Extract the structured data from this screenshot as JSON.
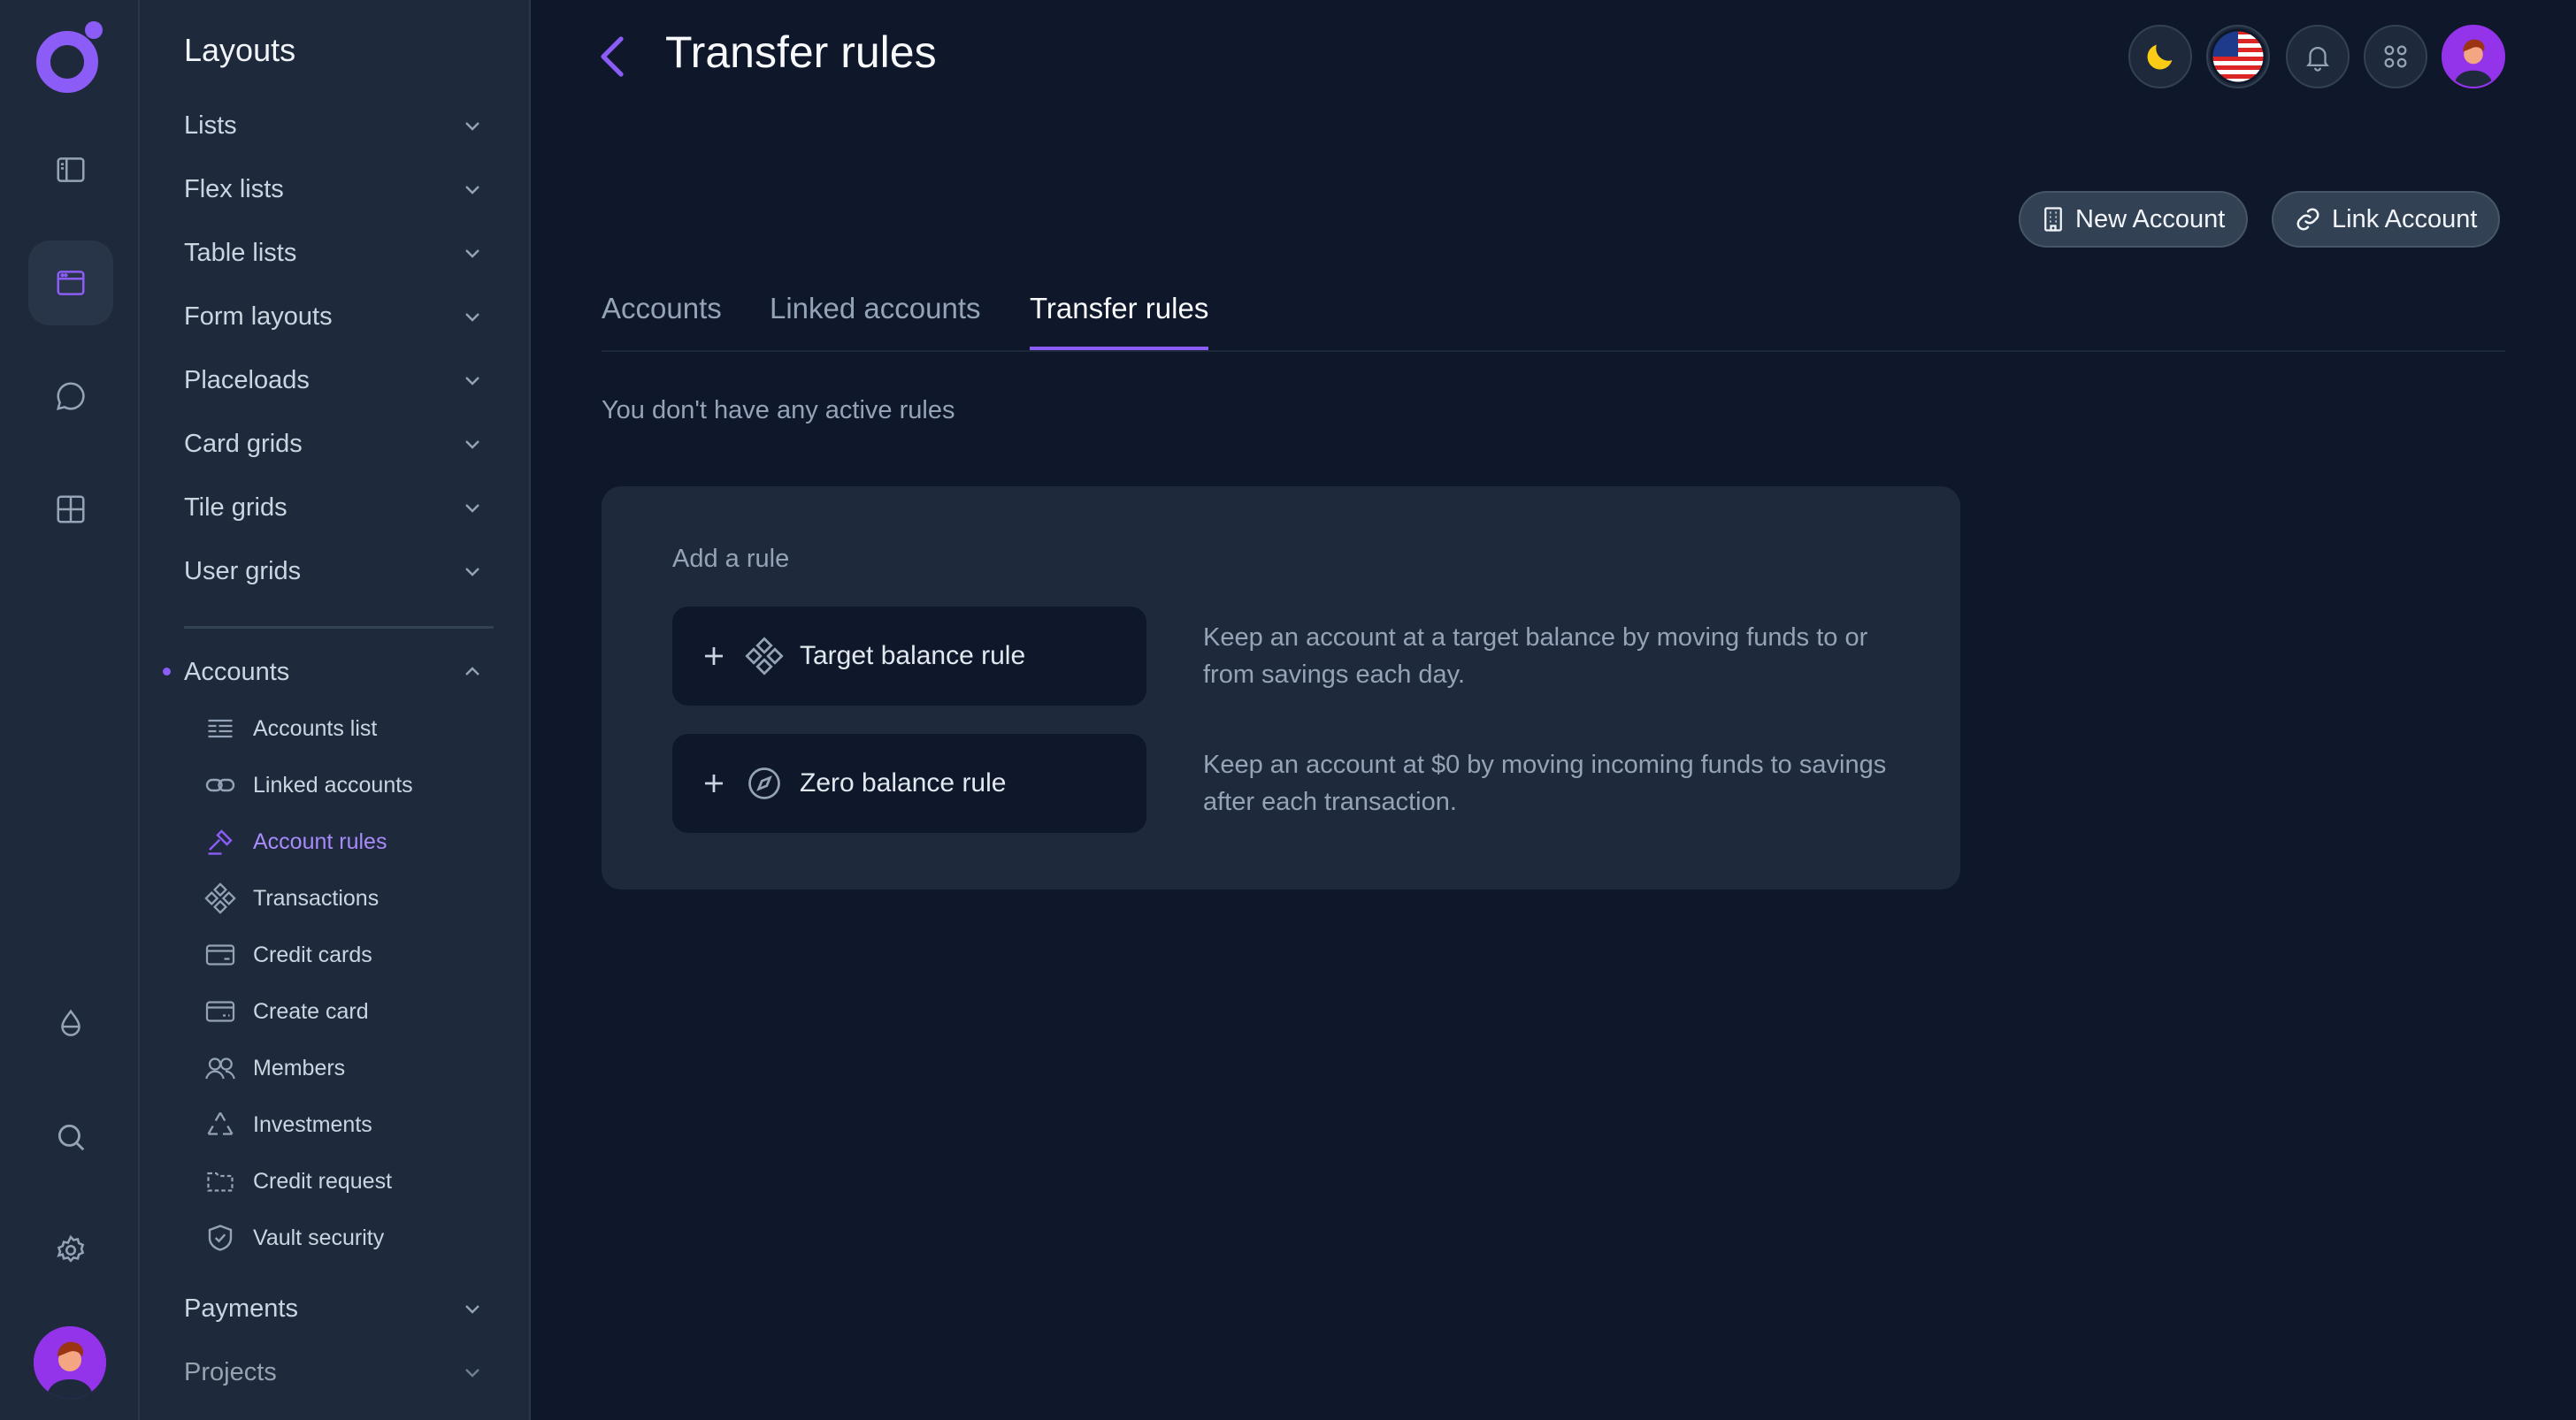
{
  "rail": {
    "icons": [
      "logo",
      "sidebar-icon",
      "window-icon",
      "chat-icon",
      "grid-icon",
      "droplet-icon",
      "search-icon",
      "gear-icon"
    ],
    "accent": "#8b5cf6"
  },
  "subnav": {
    "title": "Layouts",
    "items": [
      {
        "label": "Lists"
      },
      {
        "label": "Flex lists"
      },
      {
        "label": "Table lists"
      },
      {
        "label": "Form layouts"
      },
      {
        "label": "Placeloads"
      },
      {
        "label": "Card grids"
      },
      {
        "label": "Tile grids"
      },
      {
        "label": "User grids"
      }
    ],
    "group": {
      "label": "Accounts",
      "children": [
        {
          "label": "Accounts list",
          "icon": "list-icon"
        },
        {
          "label": "Linked accounts",
          "icon": "link-icon"
        },
        {
          "label": "Account rules",
          "icon": "gavel-icon",
          "active": true
        },
        {
          "label": "Transactions",
          "icon": "diamond-icon"
        },
        {
          "label": "Credit cards",
          "icon": "credit-card-icon"
        },
        {
          "label": "Create card",
          "icon": "create-card-icon"
        },
        {
          "label": "Members",
          "icon": "users-icon"
        },
        {
          "label": "Investments",
          "icon": "recycle-icon"
        },
        {
          "label": "Credit request",
          "icon": "folder-icon"
        },
        {
          "label": "Vault security",
          "icon": "shield-icon"
        }
      ]
    },
    "after": [
      {
        "label": "Payments"
      },
      {
        "label": "Projects"
      }
    ]
  },
  "header": {
    "title": "Transfer rules",
    "toolbar": [
      "moon-icon",
      "us-flag-icon",
      "bell-icon",
      "apps-icon",
      "avatar"
    ]
  },
  "actions": {
    "new_account": "New Account",
    "link_account": "Link Account"
  },
  "tabs": [
    {
      "label": "Accounts"
    },
    {
      "label": "Linked accounts"
    },
    {
      "label": "Transfer rules",
      "active": true
    }
  ],
  "empty_message": "You don't have any active rules",
  "card": {
    "title": "Add a rule",
    "rules": [
      {
        "label": "Target balance rule",
        "icon": "diamond-icon",
        "description": "Keep an account at a target balance by moving funds to or from savings each day."
      },
      {
        "label": "Zero balance rule",
        "icon": "compass-icon",
        "description": "Keep an account at $0 by moving incoming funds to savings after each transaction."
      }
    ]
  },
  "colors": {
    "background": "#0f172a",
    "panel": "#1e293b",
    "accent": "#8b5cf6",
    "moon": "#facc15"
  }
}
